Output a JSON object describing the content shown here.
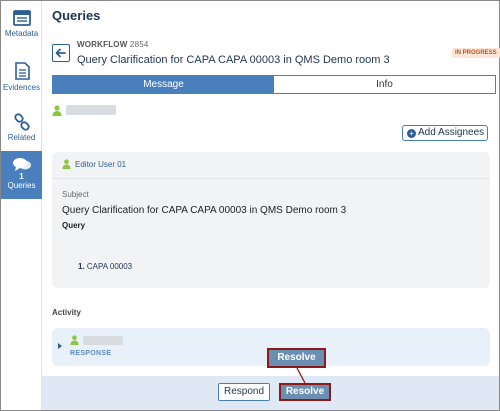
{
  "sidebar": {
    "items": [
      {
        "label": "Metadata",
        "icon": "metadata-icon"
      },
      {
        "label": "Evidences",
        "icon": "evidences-icon"
      },
      {
        "label": "Related",
        "icon": "link-icon"
      },
      {
        "label": "Queries",
        "count": "1",
        "icon": "chat-icon",
        "active": true
      }
    ]
  },
  "header": {
    "title": "Queries"
  },
  "workflow": {
    "label": "WORKFLOW",
    "number": "2854",
    "title": "Query Clarification for CAPA CAPA 00003 in QMS Demo room 3",
    "status": "IN PROGRESS"
  },
  "tabs": [
    {
      "label": "Message",
      "active": true
    },
    {
      "label": "Info",
      "active": false
    }
  ],
  "add_assignees_label": "Add Assignees",
  "message": {
    "author": "Editor User 01",
    "subject_label": "Subject",
    "subject": "Query Clarification for CAPA CAPA 00003 in QMS Demo room 3",
    "query_label": "Query",
    "query_items": [
      {
        "number": "1.",
        "text": "CAPA 00003"
      }
    ]
  },
  "activity": {
    "label": "Activity",
    "response_tag": "RESPONSE"
  },
  "footer": {
    "respond_label": "Respond",
    "resolve_label": "Resolve"
  },
  "callout": {
    "label": "Resolve"
  },
  "colors": {
    "accent": "#4a7fbd",
    "highlight_border": "#8b1a1a",
    "badge_bg": "#fde5d8",
    "badge_text": "#b5542a",
    "user_icon": "#8cc63f"
  }
}
